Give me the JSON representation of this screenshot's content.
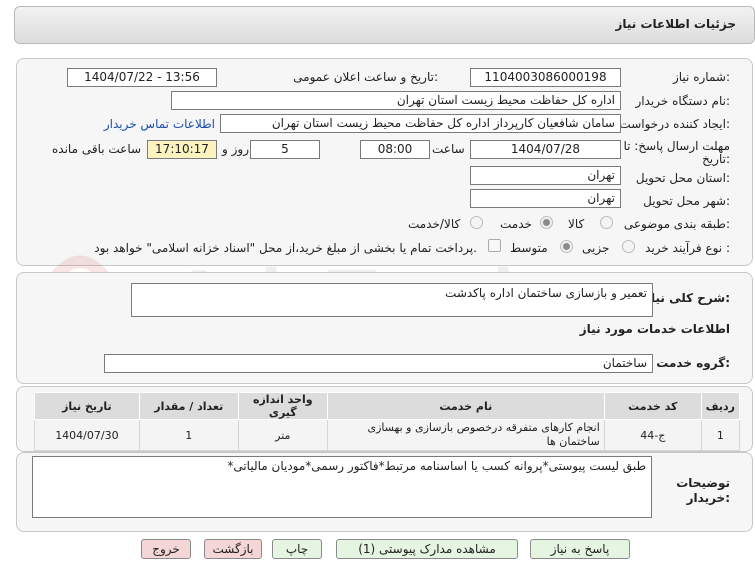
{
  "header": {
    "title": "جزئیات اطلاعات نیاز"
  },
  "form": {
    "need_number_label": "شماره نیاز:",
    "need_number": "1104003086000198",
    "announce_label": "تاریخ و ساعت اعلان عمومی:",
    "announce_value": "1404/07/22 - 13:56",
    "buyer_org_label": "نام دستگاه خریدار:",
    "buyer_org": "اداره کل حفاظت محیط زیست استان تهران",
    "creator_label": "ایجاد کننده درخواست:",
    "creator": "سامان شافعیان کارپرداز اداره کل حفاظت محیط زیست استان تهران",
    "contact_link": "اطلاعات تماس خریدار",
    "deadline_label_1": "مهلت ارسال پاسخ: تا",
    "deadline_label_2": "تاریخ:",
    "deadline_date": "1404/07/28",
    "time_label": "ساعت",
    "deadline_time": "08:00",
    "days": "5",
    "days_label": "روز و",
    "remaining_time": "17:10:17",
    "remaining_label": "ساعت باقی مانده",
    "province_label": "استان محل تحویل:",
    "province": "تهران",
    "city_label": "شهر محل تحویل:",
    "city": "تهران",
    "category_label": "طبقه بندی موضوعی:",
    "category_options": [
      "کالا",
      "خدمت",
      "کالا/خدمت"
    ],
    "category_selected": "خدمت",
    "process_label": "نوع فرآیند خرید :",
    "process_options": [
      "جزیی",
      "متوسط"
    ],
    "process_selected": "متوسط",
    "payment_note": "پرداخت تمام یا بخشی از مبلغ خرید،از محل \"اسناد خزانه اسلامی\" خواهد بود."
  },
  "summary": {
    "label": "شرح کلی نیاز:",
    "value": "تعمیر و بازسازی ساختمان اداره پاکدشت"
  },
  "services": {
    "section_title": "اطلاعات خدمات مورد نیاز",
    "group_label": "گروه خدمت:",
    "group_value": "ساختمان",
    "columns": [
      "ردیف",
      "کد خدمت",
      "نام خدمت",
      "واحد اندازه گیری",
      "تعداد / مقدار",
      "تاریخ نیاز"
    ],
    "rows": [
      {
        "row": "1",
        "code": "ج-44",
        "name": "انجام کارهای متفرقه درخصوص بازسازی و بهسازی ساختمان ها",
        "unit": "متر",
        "qty": "1",
        "date": "1404/07/30"
      }
    ]
  },
  "notes": {
    "label_1": "توضیحات",
    "label_2": "خریدار:",
    "value": "طبق لیست پیوستی*پروانه کسب یا اساسنامه مرتبط*فاکتور رسمی*مودیان مالیاتی*"
  },
  "buttons": {
    "reply": "پاسخ به نیاز",
    "attachments": "مشاهده مدارک پیوستی (1)",
    "print": "چاپ",
    "back": "بازگشت",
    "exit": "خروج"
  },
  "watermark": {
    "text": "AriaTender.net"
  },
  "colors": {
    "accent_link": "#1a4fb0",
    "highlight": "#fdf3c1",
    "button_green": "#e6f5e2",
    "button_red": "#f4d6d6"
  }
}
